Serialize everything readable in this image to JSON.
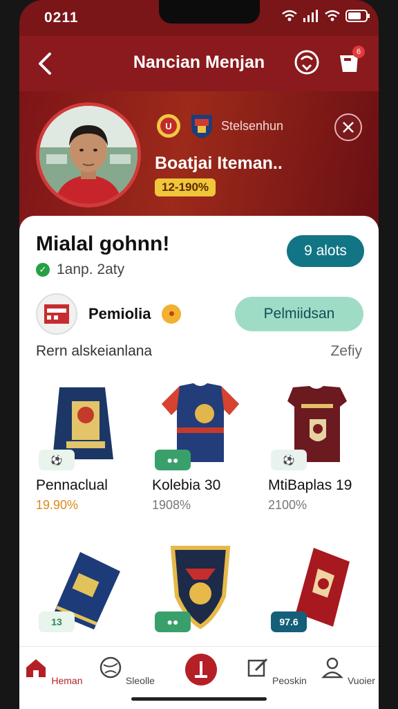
{
  "status": {
    "time": "0211"
  },
  "header": {
    "title": "Nancian Menjan",
    "cart_count": "6"
  },
  "profile": {
    "club_name": "Stelsenhun",
    "player_name": "Boatjai Iteman..",
    "ratio": "12-190%"
  },
  "card": {
    "title": "Mialal gohnn!",
    "verified_text": "1anp. 2aty",
    "slots_label": "9 alots"
  },
  "seller": {
    "name": "Pemiolia",
    "button_label": "Pelmiidsan"
  },
  "section": {
    "title": "Rern alskeianlana",
    "link": "Zefiy"
  },
  "items": [
    {
      "name": "Pennaclual",
      "price": "19.90%",
      "tag": "",
      "tag_color": "#e8f4ec",
      "price_color": "#d9891c"
    },
    {
      "name": "Kolebia 30",
      "price": "1908%",
      "tag": "",
      "tag_color": "#3aa06b",
      "price_color": "#777777"
    },
    {
      "name": "MtiBaplas 19",
      "price": "2100%",
      "tag": "",
      "tag_color": "#e8f2ee",
      "price_color": "#777777"
    },
    {
      "name": "",
      "price": "",
      "tag": "13",
      "tag_color": "#e8f4ec"
    },
    {
      "name": "",
      "price": "",
      "tag": "",
      "tag_color": "#3aa06b"
    },
    {
      "name": "",
      "price": "",
      "tag": "97.6",
      "tag_color": "#155f7a"
    }
  ],
  "nav": [
    {
      "label": "Heman",
      "icon": "home-icon",
      "active": true
    },
    {
      "label": "Sleolle",
      "icon": "ball-icon"
    },
    {
      "label": "",
      "icon": "sell-icon"
    },
    {
      "label": "Peoskin",
      "icon": "edit-icon"
    },
    {
      "label": "Vuoier",
      "icon": "profile-icon"
    }
  ],
  "colors": {
    "primary": "#8a1a1d",
    "teal": "#127585",
    "mint": "#9fdcc6",
    "gold": "#f0c63a"
  }
}
